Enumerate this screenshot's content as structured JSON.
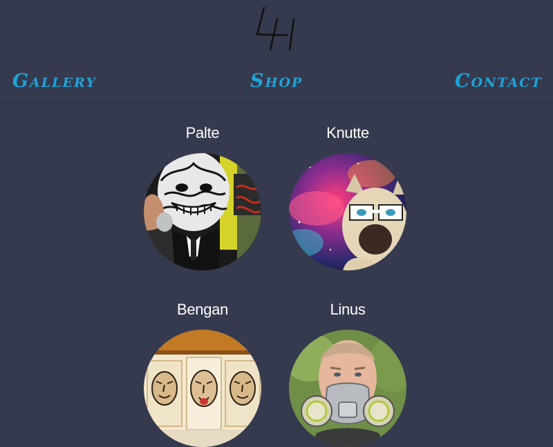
{
  "header": {
    "logo_text": "4H"
  },
  "nav": {
    "items": [
      {
        "label": "Gallery"
      },
      {
        "label": "Shop"
      },
      {
        "label": "Contact"
      }
    ],
    "link_color": "#1fa3d8"
  },
  "artists": [
    {
      "name": "Palte"
    },
    {
      "name": "Knutte"
    },
    {
      "name": "Bengan"
    },
    {
      "name": "Linus"
    }
  ],
  "colors": {
    "background": "#353a4e",
    "divider": "#2a2e3f",
    "artist_name": "#ffffff"
  }
}
